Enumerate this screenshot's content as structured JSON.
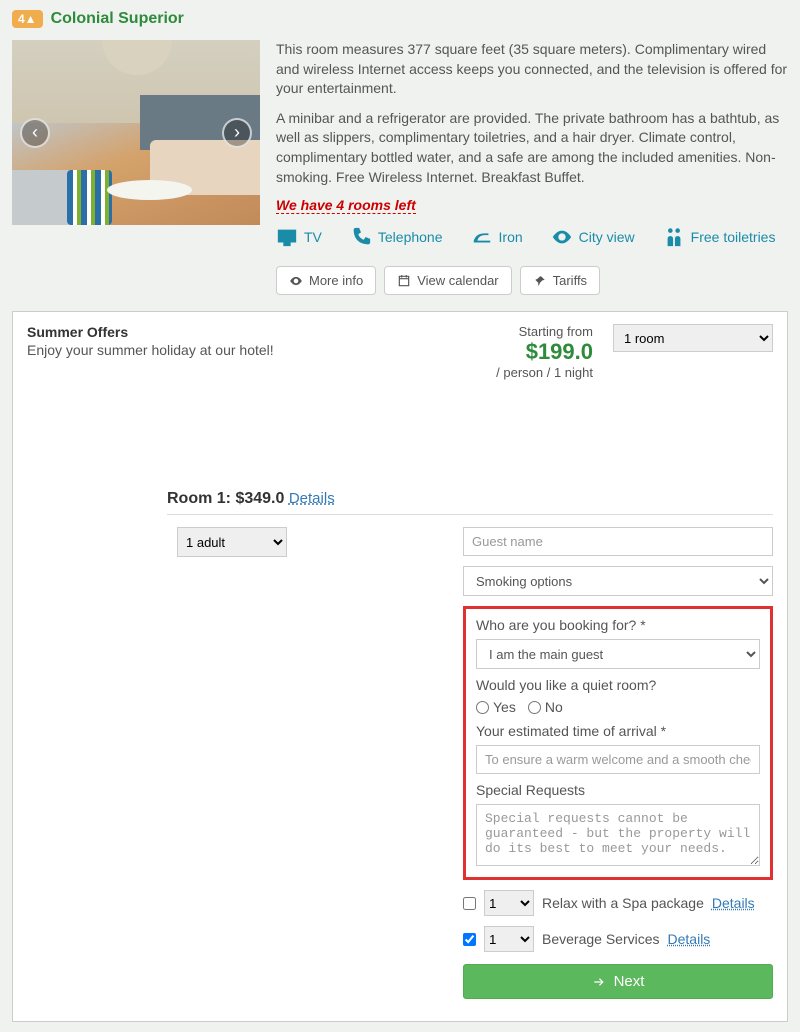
{
  "header": {
    "badge": "4▲",
    "title": "Colonial Superior"
  },
  "description": {
    "p1": "This room measures 377 square feet (35 square meters). Complimentary wired and wireless Internet access keeps you connected, and the television is offered for your entertainment.",
    "p2": "A minibar and a refrigerator are provided. The private bathroom has a bathtub, as well as slippers, complimentary toiletries, and a hair dryer. Climate control, complimentary bottled water, and a safe are among the included amenities. Non-smoking. Free Wireless Internet. Breakfast Buffet.",
    "rooms_left": "We have 4 rooms left"
  },
  "amenities": {
    "tv": "TV",
    "telephone": "Telephone",
    "iron": "Iron",
    "cityview": "City view",
    "toiletries": "Free toiletries"
  },
  "buttons": {
    "more_info": "More info",
    "view_calendar": "View calendar",
    "tariffs": "Tariffs"
  },
  "offer": {
    "title": "Summer Offers",
    "subtitle": "Enjoy your summer holiday at our hotel!",
    "starting_from": "Starting from",
    "price": "$199.0",
    "per": "/ person / 1 night",
    "room_select": "1 room"
  },
  "room": {
    "line_prefix": "Room 1: ",
    "line_price": "$349.0",
    "details": "Details",
    "adults": "1 adult",
    "guest_placeholder": "Guest name",
    "smoking": "Smoking options"
  },
  "questions": {
    "booking_for_label": "Who are you booking for? *",
    "booking_for_value": "I am the main guest",
    "quiet_label": "Would you like a quiet room?",
    "yes": "Yes",
    "no": "No",
    "arrival_label": "Your estimated time of arrival *",
    "arrival_placeholder": "To ensure a warm welcome and a smooth check in.",
    "special_label": "Special Requests",
    "special_placeholder": "Special requests cannot be guaranteed - but the property will do its best to meet your needs."
  },
  "addons": {
    "spa_qty": "1",
    "spa_label": "Relax with a Spa package",
    "bev_qty": "1",
    "bev_label": "Beverage Services",
    "details": "Details"
  },
  "next": "Next"
}
